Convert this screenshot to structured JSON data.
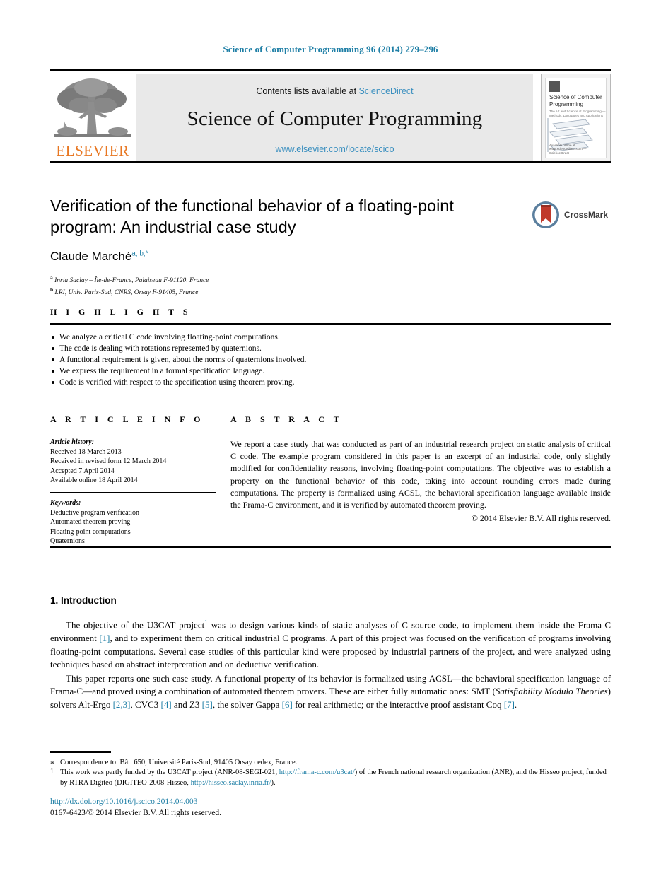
{
  "running_head": "Science of Computer Programming 96 (2014) 279–296",
  "masthead": {
    "publisher": "ELSEVIER",
    "contents_prefix": "Contents lists available at ",
    "contents_link": "ScienceDirect",
    "journal_title": "Science of Computer Programming",
    "journal_url": "www.elsevier.com/locate/scico",
    "cover": {
      "title": "Science of Computer Programming",
      "subtitle": "The Art and Science of Programming — Methods, Languages and Applications",
      "footer": "Available online at www.sciencedirect.com — ScienceDirect"
    }
  },
  "article": {
    "title": "Verification of the functional behavior of a floating-point program: An industrial case study",
    "author_name": "Claude Marché",
    "author_marks": "a, b,",
    "author_star": "*",
    "affiliations": [
      {
        "mark": "a",
        "text": "Inria Saclay – Île-de-France, Palaiseau F-91120, France"
      },
      {
        "mark": "b",
        "text": "LRI, Univ. Paris-Sud, CNRS, Orsay F-91405, France"
      }
    ],
    "crossmark_label": "CrossMark"
  },
  "highlights": {
    "heading": "H I G H L I G H T S",
    "items": [
      "We analyze a critical C code involving floating-point computations.",
      "The code is dealing with rotations represented by quaternions.",
      "A functional requirement is given, about the norms of quaternions involved.",
      "We express the requirement in a formal specification language.",
      "Code is verified with respect to the specification using theorem proving."
    ]
  },
  "article_info": {
    "heading": "A R T I C L E    I N F O",
    "history_label": "Article history:",
    "history": [
      "Received 18 March 2013",
      "Received in revised form 12 March 2014",
      "Accepted 7 April 2014",
      "Available online 18 April 2014"
    ],
    "keywords_label": "Keywords:",
    "keywords": [
      "Deductive program verification",
      "Automated theorem proving",
      "Floating-point computations",
      "Quaternions"
    ]
  },
  "abstract": {
    "heading": "A B S T R A C T",
    "text": "We report a case study that was conducted as part of an industrial research project on static analysis of critical C code. The example program considered in this paper is an excerpt of an industrial code, only slightly modified for confidentiality reasons, involving floating-point computations. The objective was to establish a property on the functional behavior of this code, taking into account rounding errors made during computations. The property is formalized using ACSL, the behavioral specification language available inside the Frama-C environment, and it is verified by automated theorem proving.",
    "copyright": "© 2014 Elsevier B.V. All rights reserved."
  },
  "introduction": {
    "heading": "1. Introduction",
    "paragraph1": {
      "part1": "The objective of the U3CAT project",
      "footnote_mark": "1",
      "part2": " was to design various kinds of static analyses of C source code, to implement them inside the Frama-C environment ",
      "ref1": "[1]",
      "part3": ", and to experiment them on critical industrial C programs. A part of this project was focused on the verification of programs involving floating-point computations. Several case studies of this particular kind were proposed by industrial partners of the project, and were analyzed using techniques based on abstract interpretation and on deductive verification."
    },
    "paragraph2": {
      "part1": "This paper reports one such case study. A functional property of its behavior is formalized using ACSL—the behavioral specification language of Frama-C—and proved using a combination of automated theorem provers. These are either fully automatic ones: SMT (",
      "italic1": "Satisfiability Modulo Theories",
      "part2": ") solvers Alt-Ergo ",
      "ref1": "[2,3]",
      "part3": ", CVC3 ",
      "ref2": "[4]",
      "part4": " and Z3 ",
      "ref3": "[5]",
      "part5": ", the solver Gappa ",
      "ref4": "[6]",
      "part6": " for real arithmetic; or the interactive proof assistant Coq ",
      "ref5": "[7]",
      "part7": "."
    }
  },
  "footnotes": {
    "correspondence_mark": "*",
    "correspondence": "Correspondence to: Bât. 650, Université Paris-Sud, 91405 Orsay cedex, France.",
    "funding_mark": "1",
    "funding_part1": "This work was partly funded by the U3CAT project (ANR-08-SEGI-021, ",
    "funding_link1": "http://frama-c.com/u3cat/",
    "funding_part2": ") of the French national research organization (ANR), and the Hisseo project, funded by RTRA Digiteo (DIGITEO-2008-Hisseo, ",
    "funding_link2": "http://hisseo.saclay.inria.fr/",
    "funding_part3": ")."
  },
  "footer": {
    "doi": "http://dx.doi.org/10.1016/j.scico.2014.04.003",
    "issn_line": "0167-6423/© 2014 Elsevier B.V. All rights reserved."
  },
  "colors": {
    "link": "#1f7fa6",
    "elsevier_orange": "#E87722",
    "masthead_bg": "#e9e9e9"
  }
}
